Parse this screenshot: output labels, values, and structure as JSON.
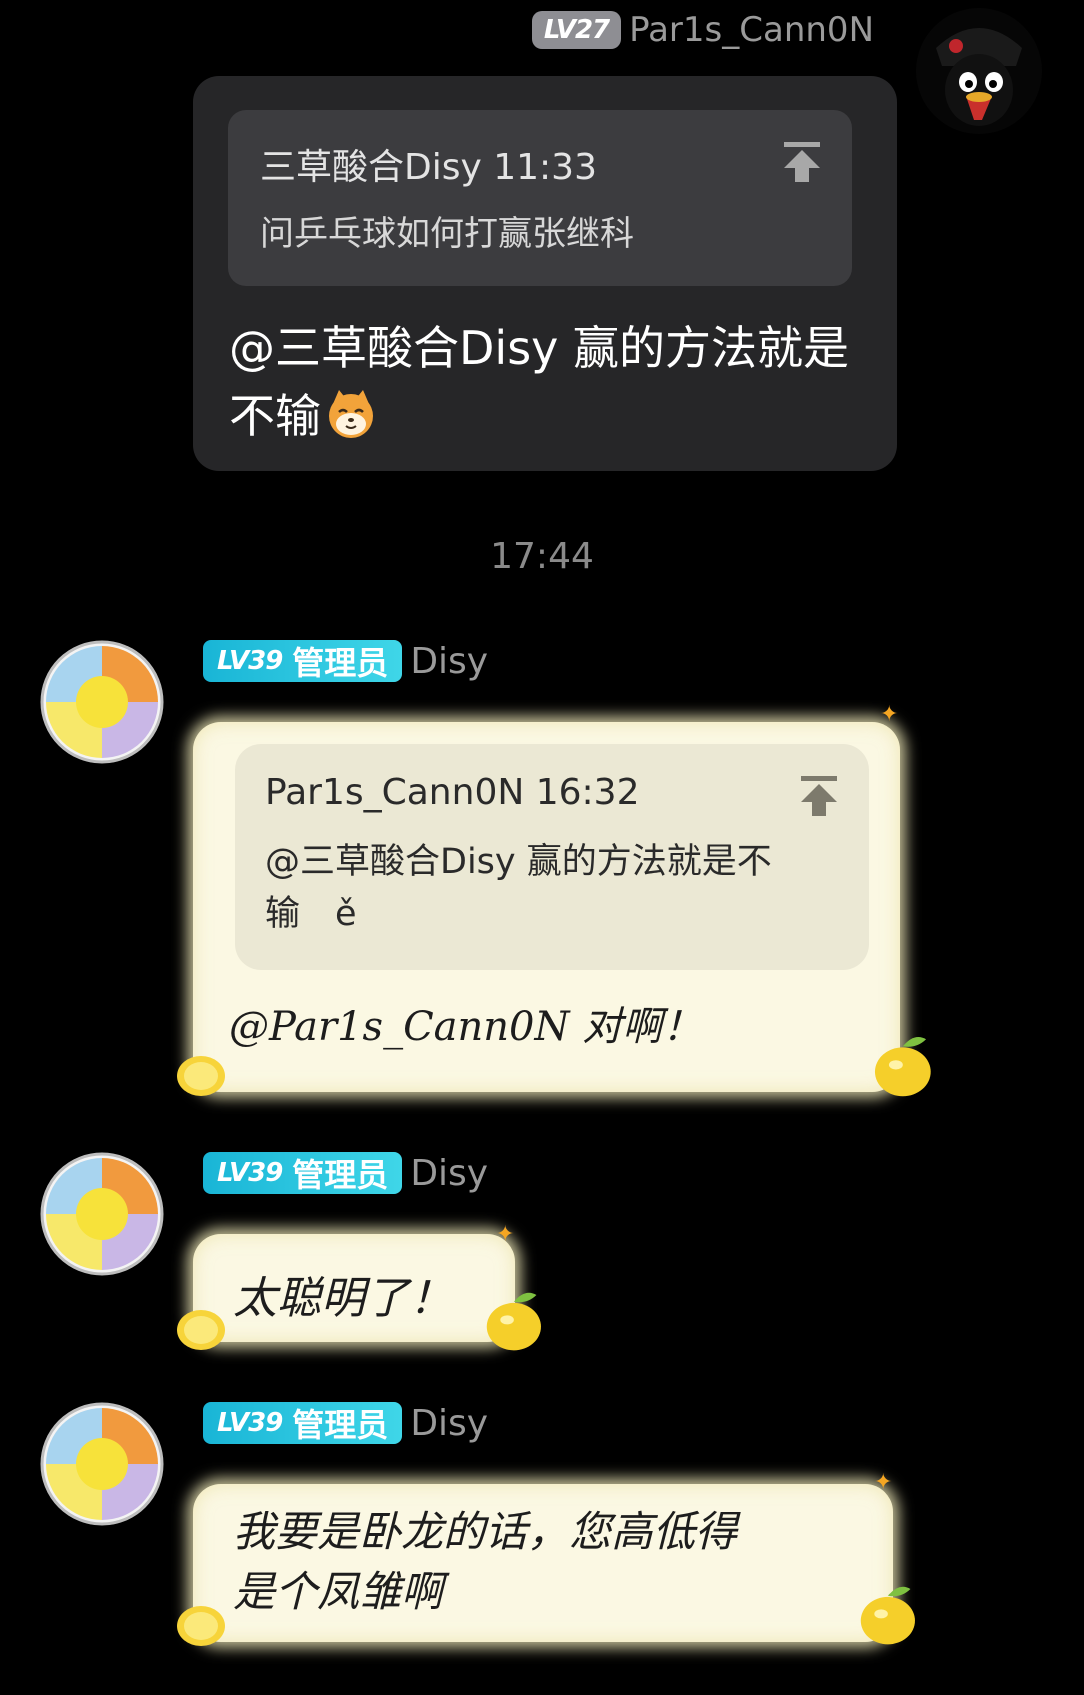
{
  "outgoing": {
    "level": "LV27",
    "sender": "Par1s_Cann0N",
    "quote": {
      "author_time": "三草酸合Disy 11:33",
      "text": "问乒乓球如何打赢张继科"
    },
    "text": "@三草酸合Disy 赢的方法就是不输"
  },
  "time_separator": "17:44",
  "incoming": [
    {
      "level": "LV39",
      "role": "管理员",
      "sender": "Disy",
      "quote": {
        "author_time": "Par1s_Cann0N 16:32",
        "line1": "@三草酸合Disy 赢的方法就是不",
        "line2": "输　ě"
      },
      "text": "@Par1s_Cann0N 对啊！"
    },
    {
      "level": "LV39",
      "role": "管理员",
      "sender": "Disy",
      "text": "太聪明了！"
    },
    {
      "level": "LV39",
      "role": "管理员",
      "sender": "Disy",
      "text_line1": "我要是卧龙的话，您高低得",
      "text_line2": "是个凤雏啊"
    }
  ],
  "colors": {
    "background": "#000000",
    "outgoing_bubble": "#262628",
    "lemon_bubble": "#fbf8e3",
    "admin_badge": "#19b5d6"
  }
}
